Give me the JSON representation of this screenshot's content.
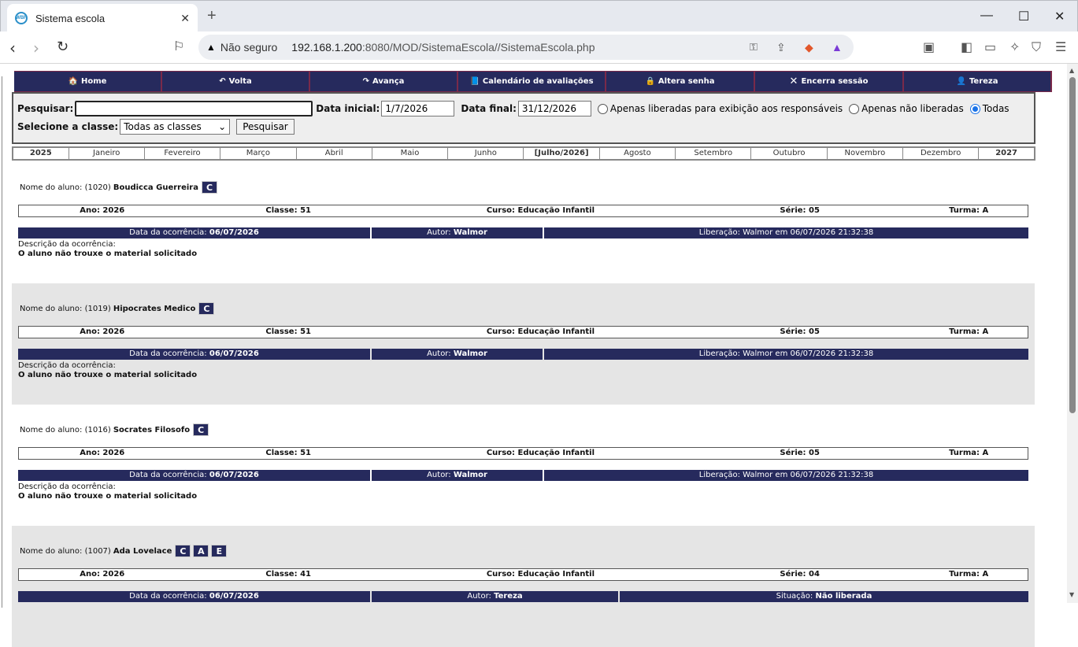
{
  "browser": {
    "tab_title": "Sistema escola",
    "favicon_text": "WBF",
    "close_tab": "✕",
    "new_tab": "+",
    "minimize": "—",
    "maximize": "☐",
    "close_window": "✕",
    "security_label": "Não seguro",
    "url_host": "192.168.1.200",
    "url_rest": ":8080/MOD/SistemaEscola//SistemaEscola.php"
  },
  "menu": {
    "items": [
      {
        "label": "Home",
        "icon": "🏠"
      },
      {
        "label": "Volta",
        "icon": "↶"
      },
      {
        "label": "Avança",
        "icon": "↷"
      },
      {
        "label": "Calendário de avaliações",
        "icon": "📘"
      },
      {
        "label": "Altera senha",
        "icon": "🔒"
      },
      {
        "label": "Encerra sessão",
        "icon": "✕"
      },
      {
        "label": "Tereza",
        "icon": "👤"
      }
    ]
  },
  "filters": {
    "search_label": "Pesquisar:",
    "search_value": "",
    "start_label": "Data inicial:",
    "start_value": "1/7/2026",
    "end_label": "Data final:",
    "end_value": "31/12/2026",
    "radio1": "Apenas liberadas para exibição aos responsáveis",
    "radio2": "Apenas não liberadas",
    "radio3": "Todas",
    "class_label": "Selecione a classe:",
    "class_value": "Todas as classes",
    "search_button": "Pesquisar"
  },
  "months": [
    "2025",
    "Janeiro",
    "Fevereiro",
    "Março",
    "Abril",
    "Maio",
    "Junho",
    "[Julho/2026]",
    "Agosto",
    "Setembro",
    "Outubro",
    "Novembro",
    "Dezembro",
    "2027"
  ],
  "records": [
    {
      "name_prefix": "Nome do aluno: (1020)",
      "name": "Boudicca Guerreira",
      "badges": [
        "C"
      ],
      "ano": "Ano: 2026",
      "classe": "Classe: 51",
      "curso": "Curso: Educação Infantil",
      "serie": "Série: 05",
      "turma": "Turma: A",
      "data_label": "Data da ocorrência:",
      "data": "06/07/2026",
      "autor_label": "Autor:",
      "autor": "Walmor",
      "liberacao": "Liberação: Walmor em 06/07/2026 21:32:38",
      "desc_label": "Descrição da ocorrência:",
      "desc": "O aluno não trouxe o material solicitado"
    },
    {
      "name_prefix": "Nome do aluno: (1019)",
      "name": "Hipocrates Medico",
      "badges": [
        "C"
      ],
      "ano": "Ano: 2026",
      "classe": "Classe: 51",
      "curso": "Curso: Educação Infantil",
      "serie": "Série: 05",
      "turma": "Turma: A",
      "data_label": "Data da ocorrência:",
      "data": "06/07/2026",
      "autor_label": "Autor:",
      "autor": "Walmor",
      "liberacao": "Liberação: Walmor em 06/07/2026 21:32:38",
      "desc_label": "Descrição da ocorrência:",
      "desc": "O aluno não trouxe o material solicitado"
    },
    {
      "name_prefix": "Nome do aluno: (1016)",
      "name": "Socrates Filosofo",
      "badges": [
        "C"
      ],
      "ano": "Ano: 2026",
      "classe": "Classe: 51",
      "curso": "Curso: Educação Infantil",
      "serie": "Série: 05",
      "turma": "Turma: A",
      "data_label": "Data da ocorrência:",
      "data": "06/07/2026",
      "autor_label": "Autor:",
      "autor": "Walmor",
      "liberacao": "Liberação: Walmor em 06/07/2026 21:32:38",
      "desc_label": "Descrição da ocorrência:",
      "desc": "O aluno não trouxe o material solicitado"
    },
    {
      "name_prefix": "Nome do aluno: (1007)",
      "name": "Ada Lovelace",
      "badges": [
        "C",
        "A",
        "E"
      ],
      "ano": "Ano: 2026",
      "classe": "Classe: 41",
      "curso": "Curso: Educação Infantil",
      "serie": "Série: 04",
      "turma": "Turma: A",
      "data_label": "Data da ocorrência:",
      "data": "06/07/2026",
      "autor_label": "Autor:",
      "autor": "Tereza",
      "situacao_label": "Situação:",
      "situacao": "Não liberada"
    }
  ]
}
